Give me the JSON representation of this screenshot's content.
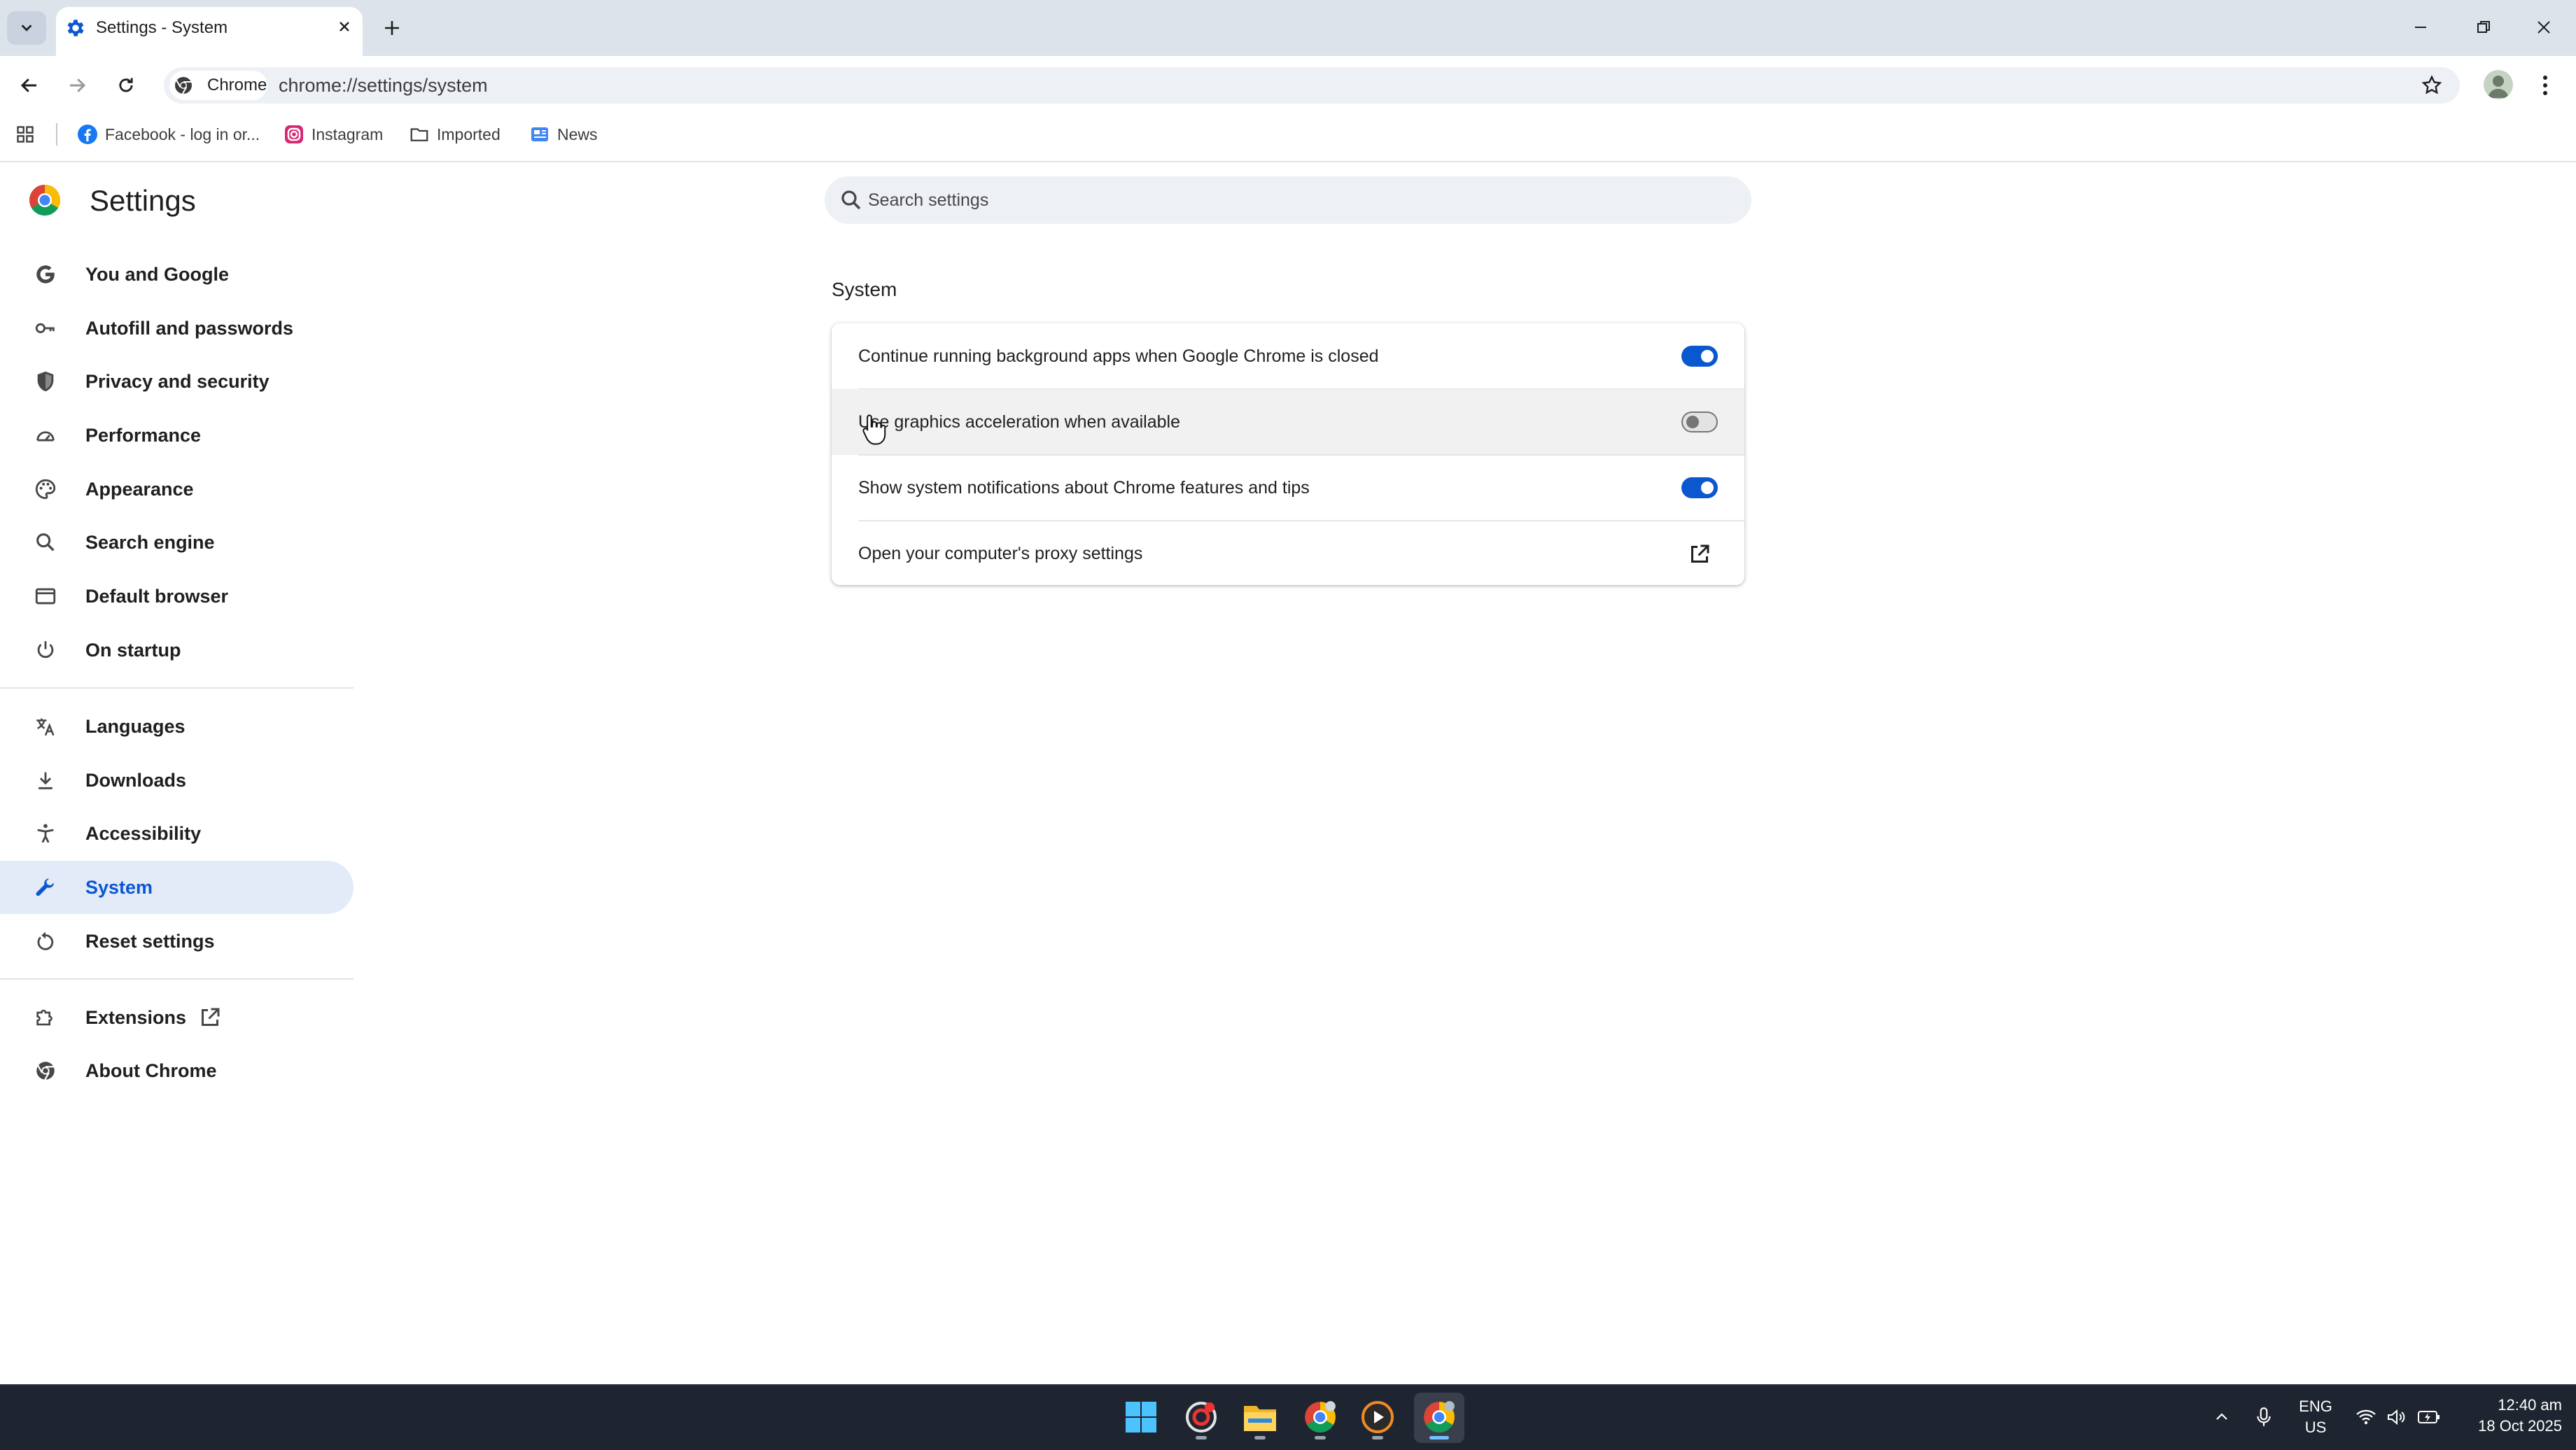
{
  "browser": {
    "tab": {
      "title": "Settings - System"
    },
    "chip_label": "Chrome",
    "url": "chrome://settings/system",
    "bookmarks": [
      {
        "label": "Facebook - log in or..."
      },
      {
        "label": "Instagram"
      },
      {
        "label": "Imported"
      },
      {
        "label": "News"
      }
    ]
  },
  "sidebar": {
    "title": "Settings",
    "items": [
      {
        "label": "You and Google",
        "icon": "google-g-icon"
      },
      {
        "label": "Autofill and passwords",
        "icon": "key-icon"
      },
      {
        "label": "Privacy and security",
        "icon": "shield-icon"
      },
      {
        "label": "Performance",
        "icon": "speedometer-icon"
      },
      {
        "label": "Appearance",
        "icon": "palette-icon"
      },
      {
        "label": "Search engine",
        "icon": "search-icon"
      },
      {
        "label": "Default browser",
        "icon": "browser-window-icon"
      },
      {
        "label": "On startup",
        "icon": "power-icon"
      },
      {
        "label": "Languages",
        "icon": "translate-icon"
      },
      {
        "label": "Downloads",
        "icon": "download-icon"
      },
      {
        "label": "Accessibility",
        "icon": "accessibility-icon"
      },
      {
        "label": "System",
        "icon": "wrench-icon",
        "active": true
      },
      {
        "label": "Reset settings",
        "icon": "reset-icon"
      },
      {
        "label": "Extensions",
        "icon": "puzzle-icon"
      },
      {
        "label": "About Chrome",
        "icon": "chrome-icon"
      }
    ]
  },
  "search": {
    "placeholder": "Search settings"
  },
  "main": {
    "section_title": "System",
    "rows": [
      {
        "label": "Continue running background apps when Google Chrome is closed",
        "toggle": true
      },
      {
        "label": "Use graphics acceleration when available",
        "toggle": false
      },
      {
        "label": "Show system notifications about Chrome features and tips",
        "toggle": true
      },
      {
        "label": "Open your computer's proxy settings",
        "external": true
      }
    ]
  },
  "taskbar": {
    "lang_line1": "ENG",
    "lang_line2": "US",
    "time": "12:40 am",
    "date": "18 Oct 2025"
  },
  "colors": {
    "accent": "#0b57d0",
    "active_nav_bg": "#e3eaf8",
    "titlebar_bg": "#dde3ea",
    "taskbar_bg": "#1f2530"
  }
}
